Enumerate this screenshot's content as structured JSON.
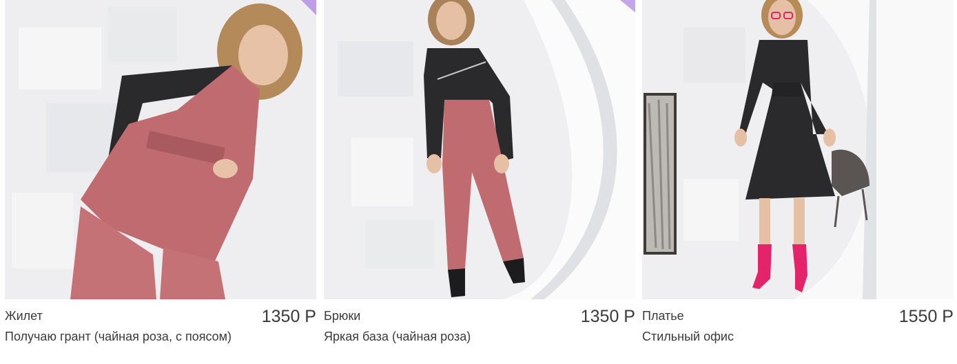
{
  "products": [
    {
      "name": "Жилет",
      "collection": "Получаю грант (чайная роза, с поясом)",
      "price": "1350 Р",
      "image": "model-pink-vest-photo"
    },
    {
      "name": "Брюки",
      "collection": "Яркая база (чайная роза)",
      "price": "1350 Р",
      "image": "model-pink-trousers-photo"
    },
    {
      "name": "Платье",
      "collection": "Стильный офис",
      "price": "1550 Р",
      "image": "model-black-dress-photo"
    }
  ],
  "colors": {
    "tea_rose": "#bf6b6f",
    "black": "#2a2a2c",
    "fuchsia": "#e4246a",
    "accent_purple": "#8a4fd8",
    "text": "#3a3a3a"
  }
}
